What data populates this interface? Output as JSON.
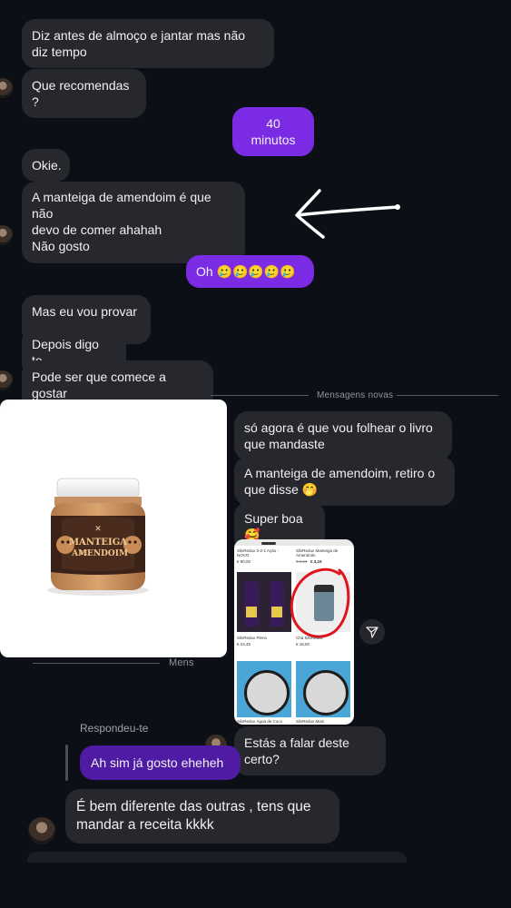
{
  "messages": {
    "m1": "Diz antes de almoço e jantar mas não diz tempo",
    "m2": "Que recomendas ?",
    "m3": "40 minutos",
    "m4": "Okie.",
    "m5_line1": "A manteiga de amendoim é que não",
    "m5_line2": "devo de comer ahahah",
    "m5_line3": "Não gosto",
    "m6": "Oh 🥲🥲🥲🥲🥲",
    "m7": "Mas eu vou provar ,",
    "m8": "Depois digo te,",
    "m9": "Pode ser que comece a gostar",
    "m10": "só agora é que vou folhear o livro que mandaste",
    "m11": "A manteiga de amendoim, retiro o que disse 🤭",
    "m12": "Super boa 🥰",
    "m13": "Estás a falar deste certo?",
    "m14": "Ah sim já gosto eheheh",
    "m15": "É bem diferente das outras , tens que mandar a receita kkkk"
  },
  "dividers": {
    "new_messages": "Mensagens novas",
    "new_messages_partial": "Mens"
  },
  "replied_label": "Respondeu-te",
  "product_image": {
    "jar_text_1": "MANTEIGA",
    "jar_text_2": "DE",
    "jar_text_3": "AMENDOIM"
  },
  "screenshot": {
    "item1_name": "SilvRedux 3-2-1 Ação - NOVO",
    "item1_price": "€ 80,00",
    "item2_name": "SilvRedux Manteiga de Amendoim",
    "item2_old_price": "€ 9,90",
    "item2_price": "€ 3,15",
    "item3_name": "SilvRedux Pleno",
    "item3_price": "€ 23,45",
    "item4_name": "Chá SilvRedux",
    "item4_price": "€ 18,50",
    "item5_name": "SilvRedux Água de Coco",
    "item6_name": "SilvRedux Mais"
  },
  "colors": {
    "background": "#0c1016",
    "bubble_other": "#26282e",
    "bubble_me": "#7b2be3",
    "bubble_me_reply": "#4f1ba4",
    "annotation": "#ffffff",
    "circle_annotation": "#e0141b"
  },
  "icons": {
    "share": "paper-plane-icon",
    "arrow": "hand-drawn-arrow"
  }
}
